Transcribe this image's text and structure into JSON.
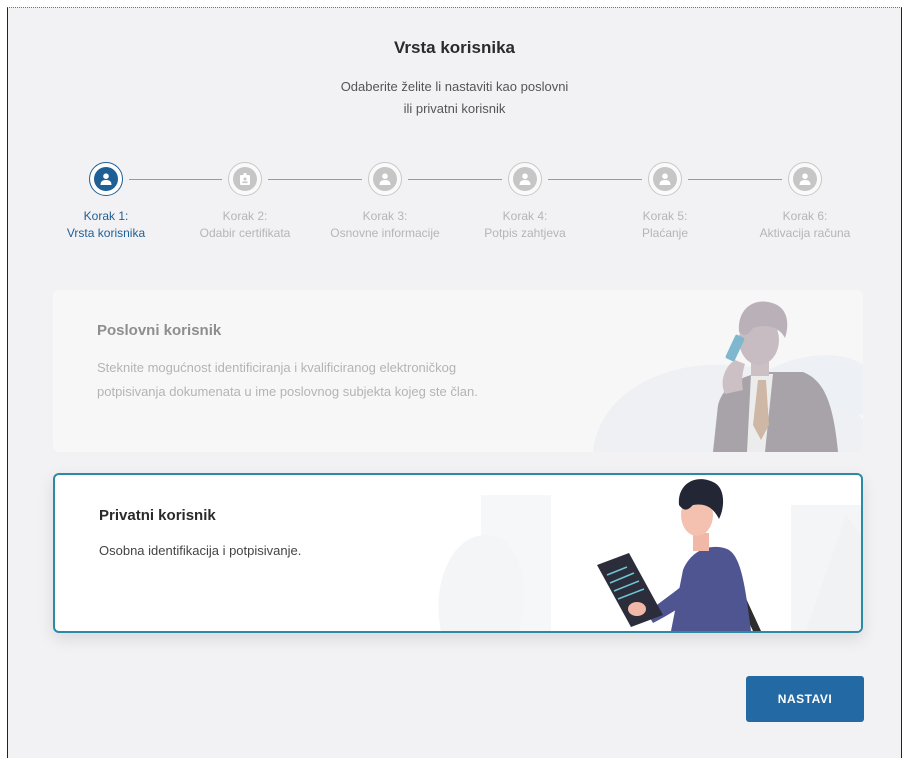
{
  "header": {
    "title": "Vrsta korisnika",
    "subtitle_line1": "Odaberite želite li nastaviti kao poslovni",
    "subtitle_line2": "ili privatni korisnik"
  },
  "steps": [
    {
      "num": "Korak 1:",
      "label": "Vrsta korisnika",
      "icon": "user-icon",
      "active": true
    },
    {
      "num": "Korak 2:",
      "label": "Odabir certifikata",
      "icon": "id-badge-icon",
      "active": false
    },
    {
      "num": "Korak 3:",
      "label": "Osnovne informacije",
      "icon": "user-icon",
      "active": false
    },
    {
      "num": "Korak 4:",
      "label": "Potpis zahtjeva",
      "icon": "user-icon",
      "active": false
    },
    {
      "num": "Korak 5:",
      "label": "Plaćanje",
      "icon": "user-icon",
      "active": false
    },
    {
      "num": "Korak 6:",
      "label": "Aktivacija računa",
      "icon": "user-icon",
      "active": false
    }
  ],
  "cards": {
    "business": {
      "title": "Poslovni korisnik",
      "desc_line1": "Steknite mogućnost identificiranja i kvalificiranog elektroničkog",
      "desc_line2": "potpisivanja dokumenata u ime poslovnog subjekta kojeg ste član.",
      "selected": false
    },
    "private": {
      "title": "Privatni korisnik",
      "desc": "Osobna identifikacija i potpisivanje.",
      "selected": true
    }
  },
  "actions": {
    "next_label": "NASTAVI"
  },
  "colors": {
    "accent": "#236aa5",
    "active_step": "#1e5f95",
    "selected_border": "#2b8aa6",
    "inactive": "#c6c6c6"
  }
}
